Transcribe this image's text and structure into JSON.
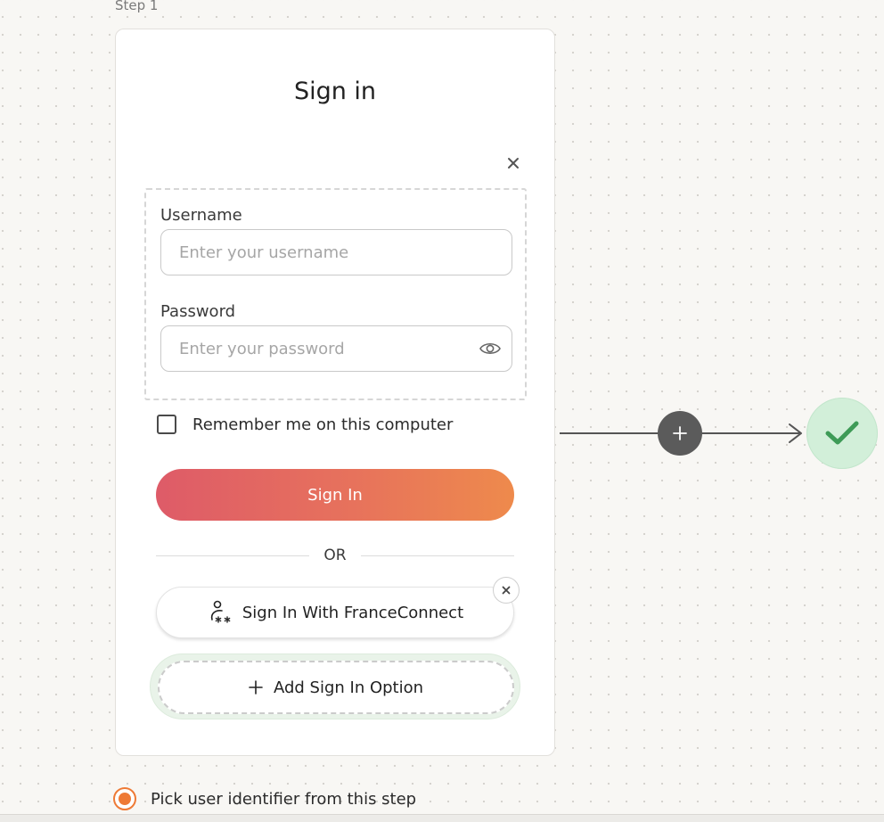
{
  "step": {
    "label": "Step 1"
  },
  "card": {
    "title": "Sign in",
    "username": {
      "label": "Username",
      "placeholder": "Enter your username",
      "value": ""
    },
    "password": {
      "label": "Password",
      "placeholder": "Enter your password",
      "value": ""
    },
    "remember": {
      "label": "Remember me on this computer",
      "checked": false
    },
    "sign_in_button": "Sign In",
    "or_text": "OR",
    "france_connect_button": "Sign In With FranceConnect",
    "add_option_button": "Add Sign In Option"
  },
  "flow": {
    "add_node_icon": "plus-icon",
    "end_node_icon": "check-icon",
    "end_node_color": "#3e9b57"
  },
  "footer": {
    "pick_identifier": {
      "label": "Pick user identifier from this step",
      "selected": true
    }
  },
  "colors": {
    "accent_start": "#de5b68",
    "accent_end": "#ee8a4c",
    "radio": "#ee7a36"
  }
}
